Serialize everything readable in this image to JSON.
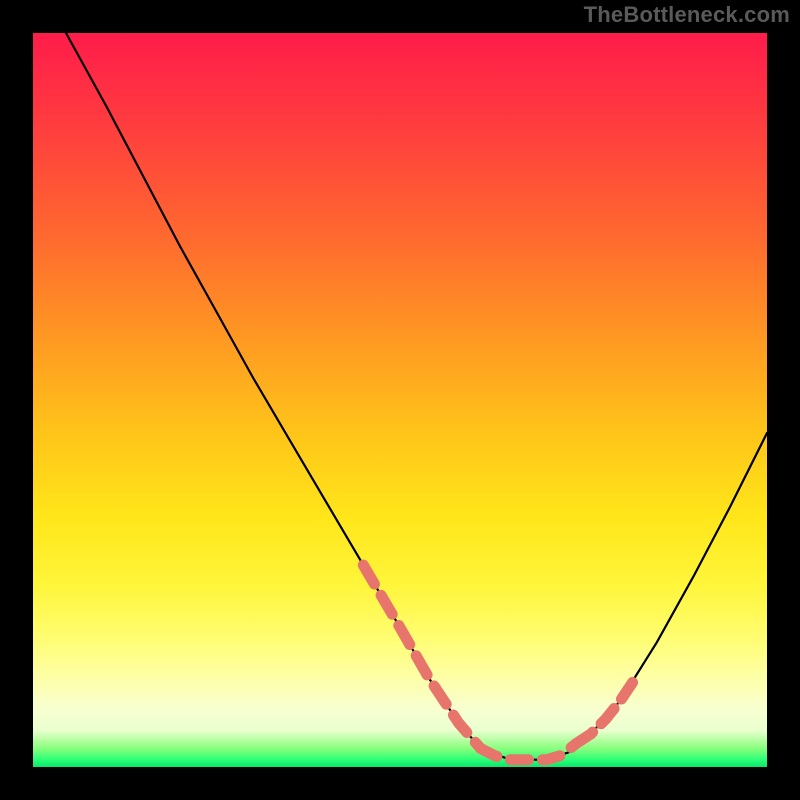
{
  "watermark": {
    "text": "TheBottleneck.com"
  },
  "chart_data": {
    "type": "line",
    "title": "",
    "xlabel": "",
    "ylabel": "",
    "xlim": [
      0,
      100
    ],
    "ylim": [
      0,
      100
    ],
    "grid": false,
    "legend": false,
    "series": [
      {
        "name": "curve",
        "style": "solid-black",
        "x": [
          4.5,
          10,
          15,
          20,
          25,
          30,
          35,
          40,
          45,
          50,
          54,
          58,
          61,
          65,
          70,
          73,
          76,
          80,
          85,
          90,
          95,
          100
        ],
        "y": [
          100,
          90,
          80.5,
          71,
          62,
          53,
          44.5,
          36,
          27.5,
          19,
          12,
          6,
          2.5,
          1,
          1,
          2,
          4.5,
          9,
          17,
          26,
          35.5,
          45.5
        ]
      },
      {
        "name": "highlight-left",
        "style": "thick-salmon-dashed",
        "x": [
          45,
          50,
          54,
          58,
          61
        ],
        "y": [
          27.5,
          19,
          12,
          6,
          2.5
        ]
      },
      {
        "name": "highlight-bottom",
        "style": "thick-salmon-dashed",
        "x": [
          61,
          63,
          65,
          67,
          70,
          72,
          74
        ],
        "y": [
          2.5,
          1.5,
          1,
          1,
          1,
          1.6,
          3.2
        ]
      },
      {
        "name": "highlight-right",
        "style": "thick-salmon-dashed",
        "x": [
          74,
          76,
          78,
          80,
          82
        ],
        "y": [
          3.2,
          4.5,
          6.5,
          9,
          12
        ]
      }
    ],
    "colors": {
      "curve": "#000000",
      "highlight": "#e8756b",
      "gradient_top": "#ff1c4a",
      "gradient_mid": "#ffe61a",
      "gradient_bottom": "#09e76a"
    }
  }
}
